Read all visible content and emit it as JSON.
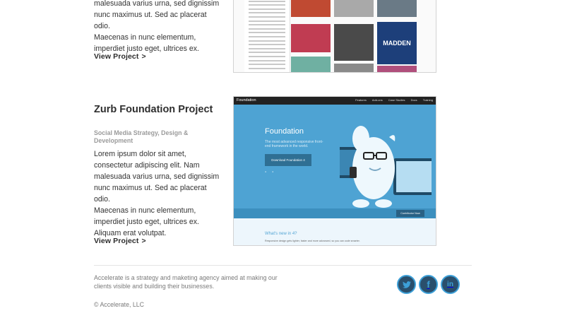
{
  "project1": {
    "desc_lines": [
      "malesuada varius urna, sed dignissim",
      "nunc maximus ut. Sed ac placerat odio.",
      "Maecenas in nunc elementum,",
      "imperdiet justo eget, ultrices ex."
    ],
    "view_label": "View Project",
    "arrow": ">",
    "thumbnail": {
      "tiles": [
        {
          "color": "#c04a32"
        },
        {
          "color": "#a9a9a9"
        },
        {
          "color": "#6a7a86"
        },
        {
          "color": "#c03c52"
        },
        {
          "color": "#4a4a4a"
        },
        {
          "color": "#d8d8d8"
        },
        {
          "color": "#6fb0a2"
        },
        {
          "color": "#8a8a8a"
        },
        {
          "color": "#b04f7c"
        }
      ],
      "madden_label": "MADDEN"
    }
  },
  "project2": {
    "title": "Zurb Foundation Project",
    "subtitle": "Social Media Strategy, Design & Development",
    "desc_lines": [
      "Lorem ipsum dolor sit amet,",
      "consectetur adipiscing elit. Nam",
      "malesuada varius urna, sed dignissim",
      "nunc maximus ut. Sed ac placerat odio.",
      "Maecenas in nunc elementum,",
      "imperdiet justo eget, ultrices ex.",
      "Aliquam erat volutpat."
    ],
    "view_label": "View Project",
    "arrow": ">",
    "thumbnail": {
      "brand": "Foundation",
      "nav_items": [
        "Features",
        "Add-ons",
        "Case Studies",
        "Docs",
        "Training"
      ],
      "hero_title": "Foundation",
      "hero_sub": "The most advanced responsive front-end framework in the world.",
      "download_label": "Download Foundation 4",
      "whats_new": "What's new in 4?",
      "whats_new_text": "Responsive design gets lighter, faster and more advanced, so you can code smarter.",
      "contributor_label": "Contributor Now"
    }
  },
  "footer": {
    "description": "Accelerate is a strategy and maketing agency aimed at making our clients visible and building their businesses.",
    "copyright": "© Accelerate, LLC",
    "social": [
      {
        "name": "twitter",
        "glyph": "🐦"
      },
      {
        "name": "facebook",
        "glyph": "f"
      },
      {
        "name": "linkedin",
        "glyph": "in"
      }
    ],
    "accent_color": "#3da0d8",
    "icon_bg": "#2a4f6c"
  }
}
